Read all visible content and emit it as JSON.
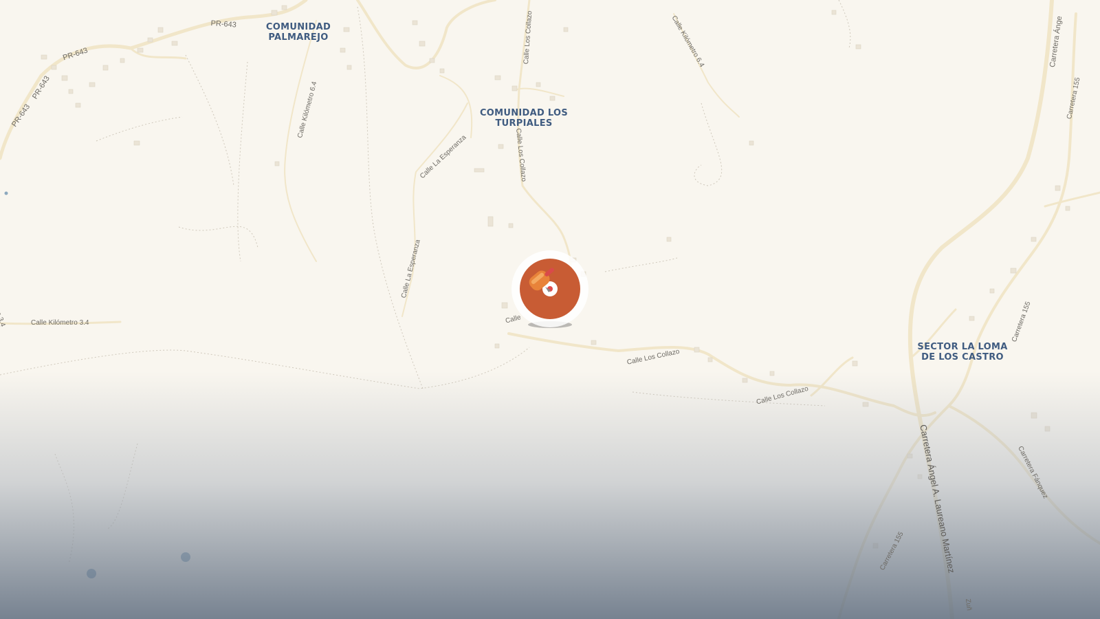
{
  "map": {
    "places": {
      "palmarejo": [
        "COMUNIDAD",
        "PALMAREJO"
      ],
      "turpiales": [
        "COMUNIDAD LOS",
        "TURPIALES"
      ],
      "loma": [
        "SECTOR LA LOMA",
        "DE LOS CASTRO"
      ]
    },
    "roads": {
      "pr643_a": "PR-643",
      "pr643_b": "PR-643",
      "pr643_c": "PR-643",
      "pr643_d": "PR-643",
      "km64_a": "Calle Kilómetro 6.4",
      "km64_b": "Calle Kilómetro 6.4",
      "collazo_a": "Calle Los Collazo",
      "collazo_b": "Calle Los Collazo",
      "collazo_c": "Calle Los Collazo",
      "collazo_d": "Calle Los Collazo",
      "esperanza_a": "Calle La Esperanza",
      "esperanza_b": "Calle La Esperanza",
      "km34": "Calle Kilómetro 3.4",
      "km34_edge": "o 3.4",
      "calle_short": "Calle",
      "carr_angel_top": "Carretera Ánge",
      "carr155_a": "Carretera 155",
      "carr155_b": "Carretera 155",
      "carr155_c": "Carretera 155",
      "laureano": "Carretera Ángel A. Laureano Martínez",
      "fanquez": "Carretera Fánquez",
      "edge_bottom": "Zuñ"
    },
    "marker": {
      "icon": "bus-stop-pin-icon",
      "color": "#c85c34"
    },
    "colors": {
      "land": "#f9f6ef",
      "road": "#f1e6c9",
      "place_label": "#3f5b80",
      "water": "#7a9bb5"
    }
  }
}
